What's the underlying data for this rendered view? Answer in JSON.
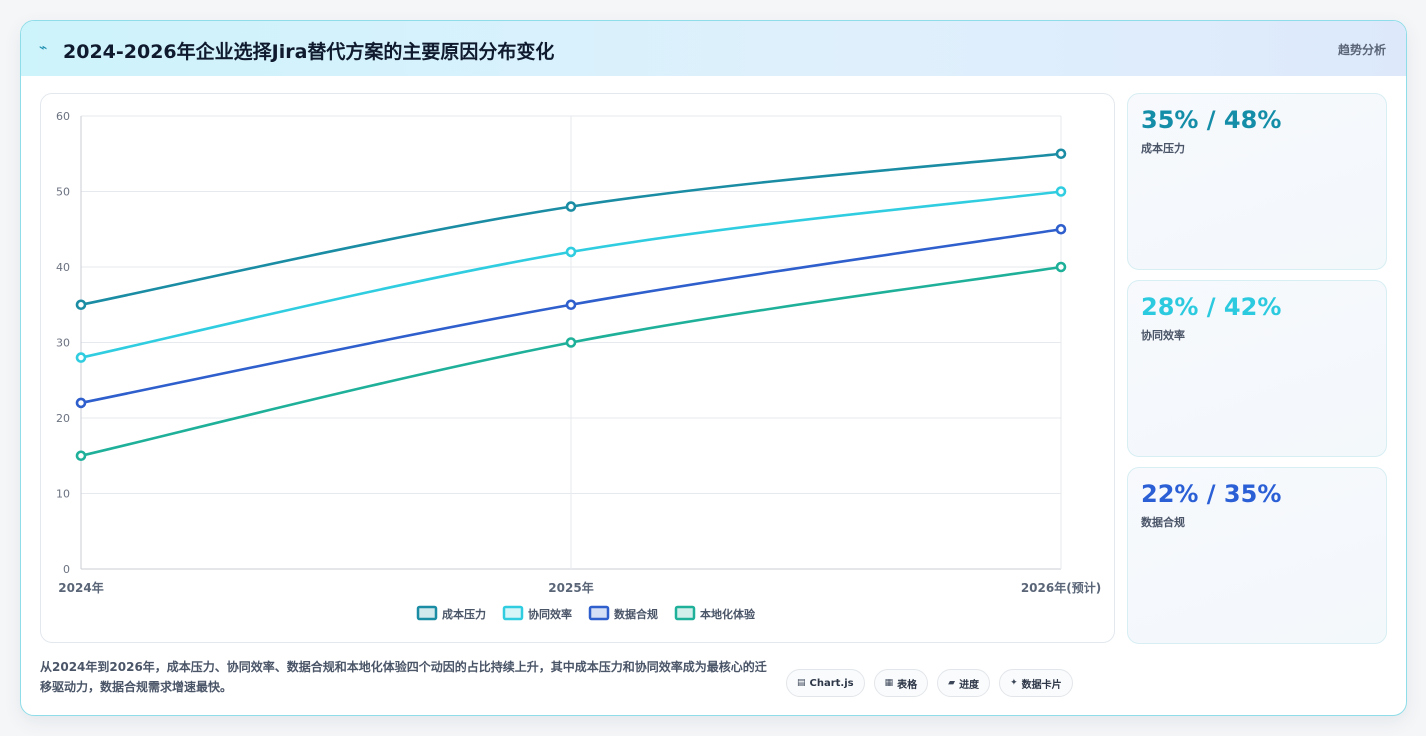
{
  "header": {
    "title": "2024-2026年企业选择Jira替代方案的主要原因分布变化",
    "right_label": "趋势分析",
    "icon": "trend-icon"
  },
  "chart_data": {
    "type": "line",
    "categories": [
      "2024年",
      "2025年",
      "2026年(预计)"
    ],
    "series": [
      {
        "name": "成本压力",
        "values": [
          35,
          48,
          55
        ],
        "color": "#1a8ca3"
      },
      {
        "name": "协同效率",
        "values": [
          28,
          42,
          50
        ],
        "color": "#30cde0"
      },
      {
        "name": "数据合规",
        "values": [
          22,
          35,
          45
        ],
        "color": "#2f5fcc"
      },
      {
        "name": "本地化体验",
        "values": [
          15,
          30,
          40
        ],
        "color": "#1fb09a"
      }
    ],
    "ylim": [
      0,
      60
    ],
    "yticks": [
      0,
      10,
      20,
      30,
      40,
      50,
      60
    ],
    "grid": true,
    "legend": "bottom-center"
  },
  "stats": [
    {
      "value": "35% / 48%",
      "label": "成本压力",
      "color": "#148ea8"
    },
    {
      "value": "28% / 42%",
      "label": "协同效率",
      "color": "#2ccadf"
    },
    {
      "value": "22% / 35%",
      "label": "数据合规",
      "color": "#2a5fd6"
    }
  ],
  "summary": "从2024年到2026年，成本压力、协同效率、数据合规和本地化体验四个动因的占比持续上升，其中成本压力和协同效率成为最核心的迁移驱动力，数据合规需求增速最快。",
  "chips": [
    {
      "icon": "▤",
      "label": "Chart.js"
    },
    {
      "icon": "▦",
      "label": "表格"
    },
    {
      "icon": "▰",
      "label": "进度"
    },
    {
      "icon": "✦",
      "label": "数据卡片"
    }
  ]
}
